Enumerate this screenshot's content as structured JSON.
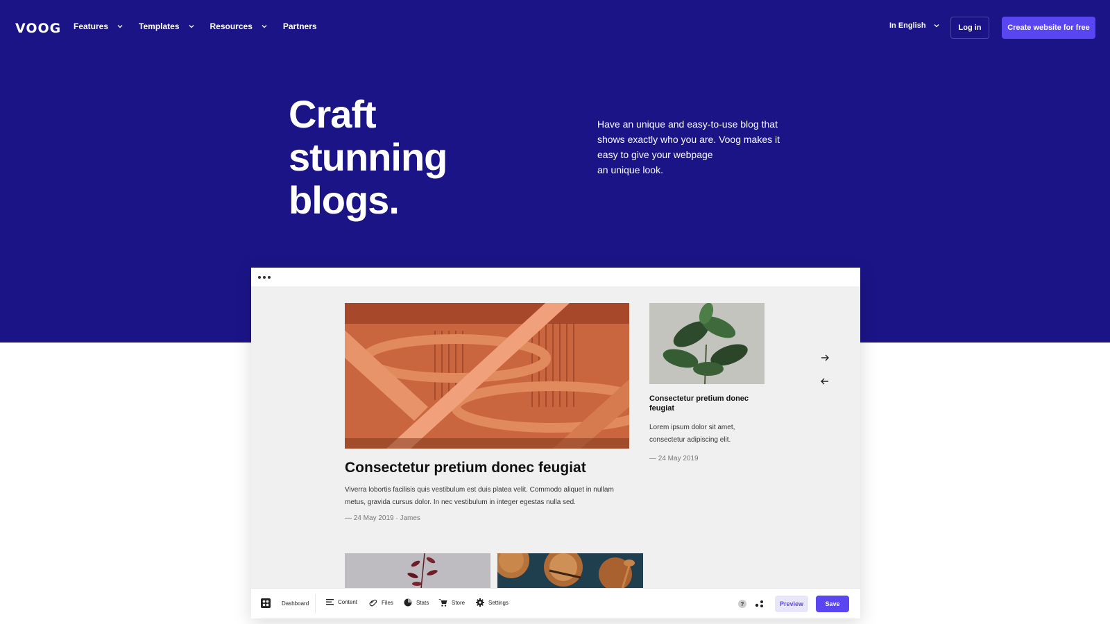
{
  "brand": {
    "logo_text": "VOOG"
  },
  "nav": {
    "items": [
      {
        "label": "Features",
        "has_dropdown": true
      },
      {
        "label": "Templates",
        "has_dropdown": true
      },
      {
        "label": "Resources",
        "has_dropdown": true
      },
      {
        "label": "Partners",
        "has_dropdown": false
      }
    ],
    "language": "In English",
    "login_label": "Log in",
    "cta_label": "Create website for free"
  },
  "hero": {
    "title_lines": [
      "Craft",
      "stunning",
      "blogs."
    ],
    "description_lines": [
      "Have an unique and easy-to-use blog that",
      "shows exactly who you are. Voog makes it",
      "easy to give your webpage",
      "an unique look."
    ]
  },
  "editor": {
    "main_post": {
      "title": "Consectetur pretium donec feugiat",
      "excerpt": "Viverra lobortis facilisis quis vestibulum est duis platea velit. Commodo aliquet in nullam metus, gravida cursus dolor. In nec vestibulum in integer egestas nulla sed.",
      "meta": "— 24 May 2019 · James"
    },
    "side_post": {
      "title": "Consectetur pretium donec feugiat",
      "excerpt": "Lorem ipsum dolor sit amet, consectetur adipiscing elit.",
      "meta": "— 24 May 2019"
    },
    "toolbar": {
      "dashboard": "Dashboard",
      "content": "Content",
      "files": "Files",
      "stats": "Stats",
      "store": "Store",
      "settings": "Settings",
      "help": "?",
      "preview": "Preview",
      "save": "Save"
    }
  },
  "colors": {
    "hero_bg": "#1b1487",
    "accent": "#5a46f0",
    "editor_bg": "#f0f0f0"
  },
  "icons": [
    "chevron-down-icon",
    "arrow-right-icon",
    "arrow-left-icon",
    "dashboard-icon",
    "content-icon",
    "files-icon",
    "stats-icon",
    "store-icon",
    "settings-icon",
    "help-icon",
    "share-icon",
    "window-dots-icon"
  ]
}
